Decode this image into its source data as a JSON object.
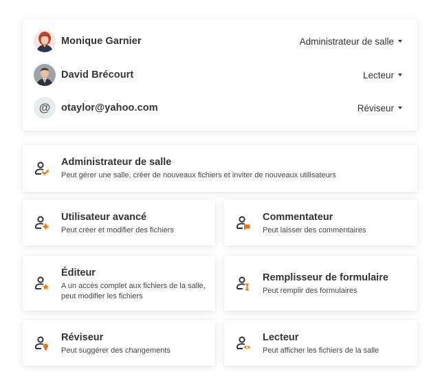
{
  "users": [
    {
      "name": "Monique Garnier",
      "role": "Administrateur de salle",
      "avatar": "photo-woman"
    },
    {
      "name": "David Brécourt",
      "role": "Lecteur",
      "avatar": "photo-man"
    },
    {
      "name": "otaylor@yahoo.com",
      "role": "Réviseur",
      "avatar": "at-icon",
      "avatar_text": "@"
    }
  ],
  "roles": {
    "admin": {
      "title": "Administrateur de salle",
      "desc": "Peut gérer une salle, créer de nouveaux fichiers et inviter de nouveaux utilisateurs",
      "icon": "user-check-icon"
    },
    "power": {
      "title": "Utilisateur avancé",
      "desc": "Peut créer et modifier des fichiers",
      "icon": "user-plus-icon"
    },
    "commenter": {
      "title": "Commentateur",
      "desc": "Peut laisser des commentaires",
      "icon": "user-comment-icon"
    },
    "editor": {
      "title": "Éditeur",
      "desc_line1": "A un accès complet aux fichiers de la salle,",
      "desc_line2": "peut modifier les fichiers",
      "icon": "user-star-icon"
    },
    "form_filler": {
      "title": "Remplisseur de formulaire",
      "desc": "Peut remplir des formulaires",
      "icon": "user-form-icon"
    },
    "reviewer": {
      "title": "Réviseur",
      "desc": "Peut suggérer des changements",
      "icon": "user-lightbulb-icon"
    },
    "reader": {
      "title": "Lecteur",
      "desc": "Peut afficher les fichiers de la salle",
      "icon": "user-eye-icon"
    }
  },
  "colors": {
    "accent": "#ed7309",
    "icon": "#333333",
    "text": "#333333"
  }
}
